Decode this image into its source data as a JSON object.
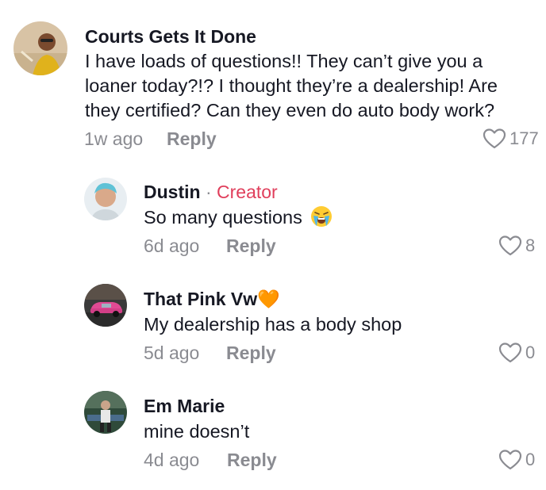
{
  "comments": [
    {
      "username": "Courts Gets It Done",
      "text": "I have loads of questions!! They can’t give you a loaner today?!? I thought they’re a dealership! Are they certified? Can they even do auto body work?",
      "age": "1w ago",
      "reply_label": "Reply",
      "likes": "177"
    },
    {
      "username": "Dustin",
      "separator": "·",
      "creator_label": "Creator",
      "text": "So many questions",
      "emoji": "loudly-crying-face",
      "age": "6d ago",
      "reply_label": "Reply",
      "likes": "8"
    },
    {
      "username": "That Pink Vw🧡",
      "text": "My dealership has a body shop",
      "age": "5d ago",
      "reply_label": "Reply",
      "likes": "0"
    },
    {
      "username": "Em Marie",
      "text": "mine doesn’t",
      "age": "4d ago",
      "reply_label": "Reply",
      "likes": "0"
    }
  ],
  "colors": {
    "text_primary": "#161823",
    "text_secondary": "#8a8b91",
    "creator_accent": "#e03e5b"
  },
  "icons": {
    "like": "heart-outline-icon"
  }
}
